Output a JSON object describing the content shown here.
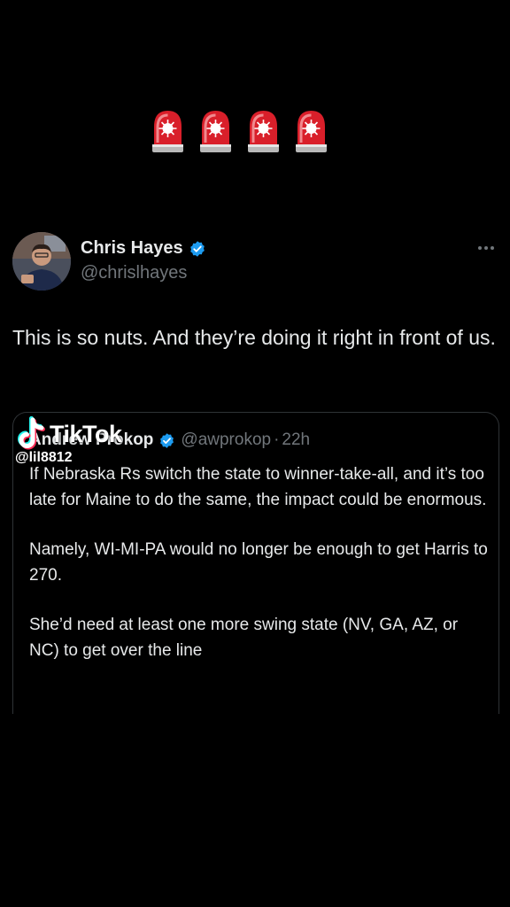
{
  "header": {
    "emoji_row": [
      "🚨",
      "🚨",
      "🚨",
      "🚨"
    ]
  },
  "tweet": {
    "author_name": "Chris Hayes",
    "author_handle": "@chrislhayes",
    "verified": true,
    "text": "This is so nuts. And they’re doing it right in front of us.",
    "quote": {
      "author_name": "Andrew Prokop",
      "author_handle": "@awprokop",
      "separator": "·",
      "time": "22h",
      "verified": true,
      "paragraphs": [
        "If Nebraska Rs switch the state to winner-take-all, and it’s too late for Maine to do the same, the impact could be enormous.",
        "Namely, WI-MI-PA would no longer be enough to get Harris to 270.",
        "She’d need at least one more swing state (NV, GA, AZ, or NC) to get over the line"
      ]
    }
  },
  "watermark": {
    "brand": "TikTok",
    "username": "@lil8812"
  },
  "colors": {
    "background": "#000000",
    "text_primary": "#e7e9ea",
    "text_secondary": "#71767b",
    "verified_blue": "#1d9bf0",
    "card_border": "#2f3336",
    "siren_red": "#e0242f"
  },
  "icons": {
    "siren": "police-car-light-emoji",
    "verified": "verified-badge-icon",
    "more": "more-options-icon",
    "tiktok": "tiktok-logo-icon"
  }
}
